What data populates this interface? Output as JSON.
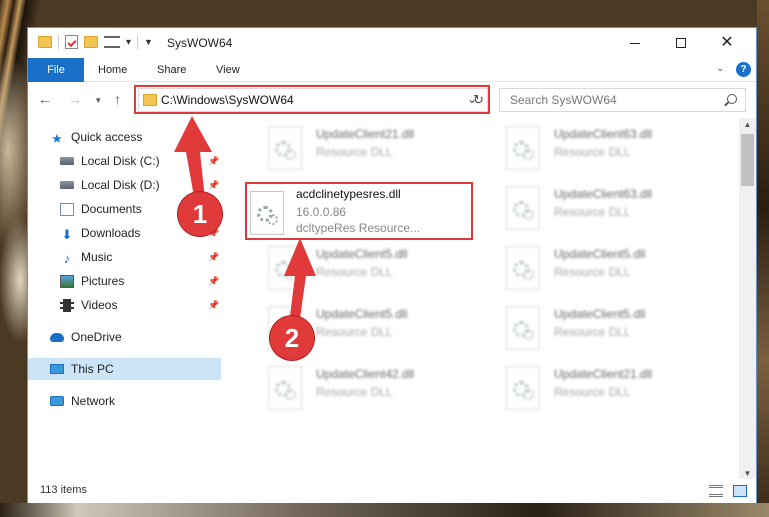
{
  "window": {
    "title": "SysWOW64",
    "minimize_label": "",
    "maximize_label": "",
    "close_label": "✕"
  },
  "ribbon": {
    "tabs": [
      "File",
      "Home",
      "Share",
      "View"
    ]
  },
  "address": {
    "path": "C:\\Windows\\SysWOW64"
  },
  "search": {
    "placeholder": "Search SysWOW64"
  },
  "navpane": {
    "items": [
      {
        "label": "Quick access",
        "icon": "star-icon",
        "pinned": false
      },
      {
        "label": "Local Disk (C:)",
        "icon": "disk-icon",
        "pinned": true
      },
      {
        "label": "Local Disk (D:)",
        "icon": "disk-icon",
        "pinned": true
      },
      {
        "label": "Documents",
        "icon": "document-icon",
        "pinned": true
      },
      {
        "label": "Downloads",
        "icon": "download-icon",
        "pinned": true
      },
      {
        "label": "Music",
        "icon": "music-icon",
        "pinned": true
      },
      {
        "label": "Pictures",
        "icon": "pictures-icon",
        "pinned": true
      },
      {
        "label": "Videos",
        "icon": "videos-icon",
        "pinned": true
      },
      {
        "label": "OneDrive",
        "icon": "cloud-icon",
        "pinned": false
      },
      {
        "label": "This PC",
        "icon": "computer-icon",
        "pinned": false,
        "selected": true
      },
      {
        "label": "Network",
        "icon": "network-icon",
        "pinned": false
      }
    ]
  },
  "files": {
    "main": {
      "name": "acdclinetypesres.dll",
      "version": "16.0.0.86",
      "description": "dcltypeRes Resource..."
    },
    "blurred": [
      {
        "name": "UpdateClient21.dll",
        "type": "Resource DLL"
      },
      {
        "name": "UpdateClient63.dll",
        "type": "Resource DLL"
      },
      {
        "name": "UpdateClient5.dll",
        "type": "Resource DLL"
      },
      {
        "name": "UpdateClient5.dll",
        "type": "Resource DLL"
      },
      {
        "name": "UpdateClient63.dll",
        "type": "Resource DLL"
      },
      {
        "name": "UpdateClient5.dll",
        "type": "Resource DLL"
      },
      {
        "name": "UpdateClient5.dll",
        "type": "Resource DLL"
      },
      {
        "name": "UpdateClient42.dll",
        "type": "Resource DLL"
      },
      {
        "name": "UpdateClient21.dll",
        "type": "Resource DLL"
      }
    ]
  },
  "status": {
    "count": "113 items"
  },
  "annotations": {
    "badge1": "1",
    "badge2": "2",
    "color": "#e03a3a"
  }
}
